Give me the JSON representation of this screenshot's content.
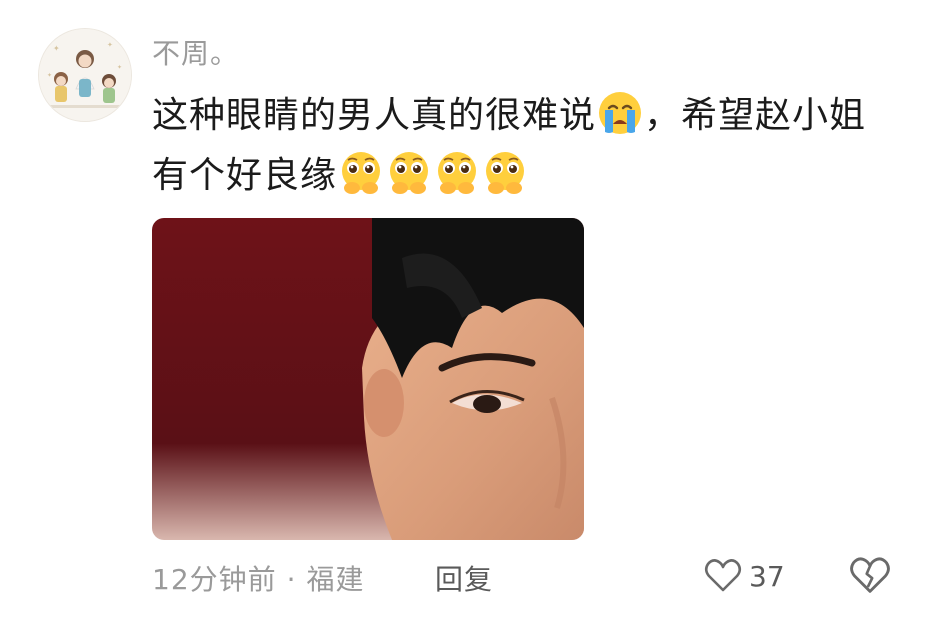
{
  "comment": {
    "username": "不周。",
    "text_line1": "这种眼睛的男人真的很难说",
    "text_after_emoji": "，希望赵小姐",
    "text_line2": "有个好良缘",
    "inline_emoji_1": "loudly-crying-face-icon",
    "inline_emoji_2": "pleading-face-icon",
    "pleading_emoji_count": 4,
    "photo_icon": "face-closeup-photo",
    "time": "12分钟前",
    "separator": "·",
    "location": "福建",
    "reply_label": "回复",
    "like_count": "37",
    "like_icon": "heart-outline-icon",
    "dislike_icon": "broken-heart-icon"
  }
}
